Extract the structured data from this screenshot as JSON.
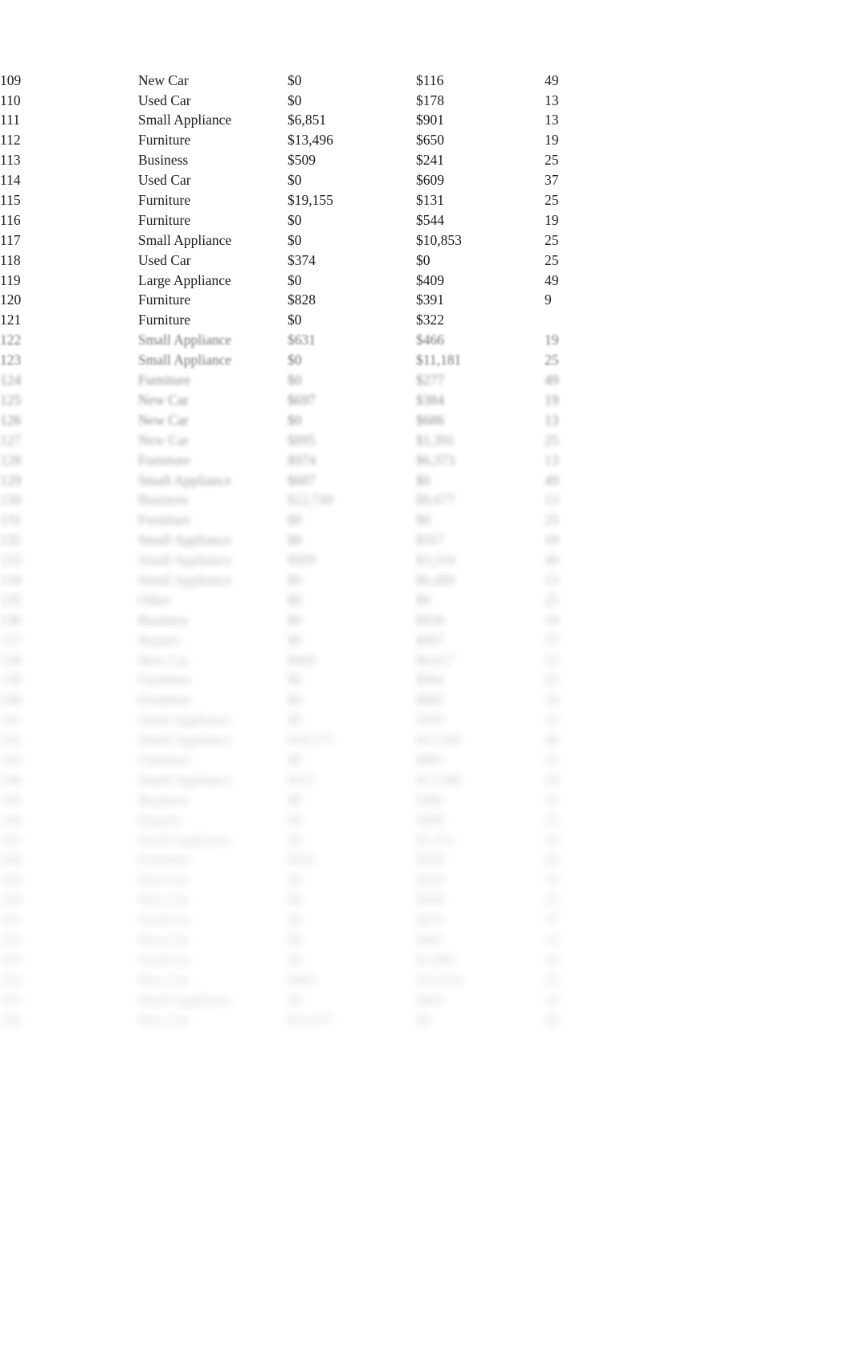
{
  "document": {
    "kind": "spreadsheet-data-table",
    "background_color": "#ffffff",
    "text_color": "#1a1a1a",
    "columns": [
      {
        "key": "index",
        "name": "row-number",
        "align": "right"
      },
      {
        "key": "category",
        "name": "loan-category",
        "align": "right"
      },
      {
        "key": "amount1",
        "name": "amount-column-1",
        "align": "right"
      },
      {
        "key": "amount2",
        "name": "amount-column-2",
        "align": "right"
      },
      {
        "key": "count",
        "name": "count-column",
        "align": "right"
      }
    ],
    "rows": [
      {
        "index": "109",
        "category": "New Car",
        "amount1": "$0",
        "amount2": "$116",
        "count": "49",
        "blur": 0
      },
      {
        "index": "110",
        "category": "Used Car",
        "amount1": "$0",
        "amount2": "$178",
        "count": "13",
        "blur": 0
      },
      {
        "index": "111",
        "category": "Small Appliance",
        "amount1": "$6,851",
        "amount2": "$901",
        "count": "13",
        "blur": 0
      },
      {
        "index": "112",
        "category": "Furniture",
        "amount1": "$13,496",
        "amount2": "$650",
        "count": "19",
        "blur": 0
      },
      {
        "index": "113",
        "category": "Business",
        "amount1": "$509",
        "amount2": "$241",
        "count": "25",
        "blur": 0
      },
      {
        "index": "114",
        "category": "Used Car",
        "amount1": "$0",
        "amount2": "$609",
        "count": "37",
        "blur": 0
      },
      {
        "index": "115",
        "category": "Furniture",
        "amount1": "$19,155",
        "amount2": "$131",
        "count": "25",
        "blur": 0
      },
      {
        "index": "116",
        "category": "Furniture",
        "amount1": "$0",
        "amount2": "$544",
        "count": "19",
        "blur": 0
      },
      {
        "index": "117",
        "category": "Small Appliance",
        "amount1": "$0",
        "amount2": "$10,853",
        "count": "25",
        "blur": 0
      },
      {
        "index": "118",
        "category": "Used Car",
        "amount1": "$374",
        "amount2": "$0",
        "count": "25",
        "blur": 0
      },
      {
        "index": "119",
        "category": "Large Appliance",
        "amount1": "$0",
        "amount2": "$409",
        "count": "49",
        "blur": 0
      },
      {
        "index": "120",
        "category": "Furniture",
        "amount1": "$828",
        "amount2": "$391",
        "count": "9",
        "blur": 0
      },
      {
        "index": "121",
        "category": "Furniture",
        "amount1": "$0",
        "amount2": "$322",
        "count": "",
        "blur": 0
      },
      {
        "index": "122",
        "category": "Small Appliance",
        "amount1": "$631",
        "amount2": "$466",
        "count": "19",
        "blur": 1
      },
      {
        "index": "123",
        "category": "Small Appliance",
        "amount1": "$0",
        "amount2": "$11,181",
        "count": "25",
        "blur": 1
      },
      {
        "index": "124",
        "category": "Furniture",
        "amount1": "$0",
        "amount2": "$277",
        "count": "49",
        "blur": 2
      },
      {
        "index": "125",
        "category": "New Car",
        "amount1": "$697",
        "amount2": "$384",
        "count": "19",
        "blur": 2
      },
      {
        "index": "126",
        "category": "New Car",
        "amount1": "$0",
        "amount2": "$686",
        "count": "13",
        "blur": 2
      },
      {
        "index": "127",
        "category": "New Car",
        "amount1": "$895",
        "amount2": "$1,391",
        "count": "25",
        "blur": 3
      },
      {
        "index": "128",
        "category": "Furniture",
        "amount1": "$974",
        "amount2": "$6,373",
        "count": "13",
        "blur": 3
      },
      {
        "index": "129",
        "category": "Small Appliance",
        "amount1": "$687",
        "amount2": "$0",
        "count": "49",
        "blur": 3
      },
      {
        "index": "130",
        "category": "Business",
        "amount1": "$12,749",
        "amount2": "$8,677",
        "count": "13",
        "blur": 4
      },
      {
        "index": "131",
        "category": "Furniture",
        "amount1": "$0",
        "amount2": "$0",
        "count": "25",
        "blur": 4
      },
      {
        "index": "132",
        "category": "Small Appliance",
        "amount1": "$0",
        "amount2": "$317",
        "count": "19",
        "blur": 4
      },
      {
        "index": "133",
        "category": "Small Appliance",
        "amount1": "$689",
        "amount2": "$3,334",
        "count": "49",
        "blur": 5
      },
      {
        "index": "134",
        "category": "Small Appliance",
        "amount1": "$0",
        "amount2": "$6,489",
        "count": "13",
        "blur": 5
      },
      {
        "index": "135",
        "category": "Other",
        "amount1": "$0",
        "amount2": "$0",
        "count": "25",
        "blur": 5
      },
      {
        "index": "136",
        "category": "Business",
        "amount1": "$0",
        "amount2": "$936",
        "count": "19",
        "blur": 5
      },
      {
        "index": "137",
        "category": "Repairs",
        "amount1": "$0",
        "amount2": "$887",
        "count": "37",
        "blur": 6
      },
      {
        "index": "138",
        "category": "New Car",
        "amount1": "$849",
        "amount2": "$6,617",
        "count": "13",
        "blur": 6
      },
      {
        "index": "139",
        "category": "Furniture",
        "amount1": "$0",
        "amount2": "$964",
        "count": "25",
        "blur": 6
      },
      {
        "index": "140",
        "category": "Furniture",
        "amount1": "$0",
        "amount2": "$802",
        "count": "19",
        "blur": 6
      },
      {
        "index": "141",
        "category": "Small Appliance",
        "amount1": "$0",
        "amount2": "$303",
        "count": "13",
        "blur": 7
      },
      {
        "index": "142",
        "category": "Small Appliance",
        "amount1": "$10,373",
        "amount2": "$11,568",
        "count": "49",
        "blur": 7
      },
      {
        "index": "143",
        "category": "Furniture",
        "amount1": "$0",
        "amount2": "$881",
        "count": "25",
        "blur": 7
      },
      {
        "index": "144",
        "category": "Small Appliance",
        "amount1": "$317",
        "amount2": "$13,506",
        "count": "19",
        "blur": 7
      },
      {
        "index": "145",
        "category": "Business",
        "amount1": "$0",
        "amount2": "$282",
        "count": "13",
        "blur": 7
      },
      {
        "index": "146",
        "category": "Repairs",
        "amount1": "$0",
        "amount2": "$889",
        "count": "25",
        "blur": 8
      },
      {
        "index": "147",
        "category": "Small Appliance",
        "amount1": "$0",
        "amount2": "$1,251",
        "count": "19",
        "blur": 8
      },
      {
        "index": "148",
        "category": "Furniture",
        "amount1": "$935",
        "amount2": "$399",
        "count": "49",
        "blur": 8
      },
      {
        "index": "149",
        "category": "New Car",
        "amount1": "$0",
        "amount2": "$566",
        "count": "13",
        "blur": 8
      },
      {
        "index": "150",
        "category": "New Car",
        "amount1": "$0",
        "amount2": "$690",
        "count": "25",
        "blur": 8
      },
      {
        "index": "151",
        "category": "Used Car",
        "amount1": "$0",
        "amount2": "$473",
        "count": "37",
        "blur": 8
      },
      {
        "index": "152",
        "category": "New Car",
        "amount1": "$0",
        "amount2": "$607",
        "count": "13",
        "blur": 8
      },
      {
        "index": "153",
        "category": "Used Car",
        "amount1": "$0",
        "amount2": "$1,066",
        "count": "19",
        "blur": 8
      },
      {
        "index": "154",
        "category": "New Car",
        "amount1": "$683",
        "amount2": "$12,254",
        "count": "25",
        "blur": 8
      },
      {
        "index": "155",
        "category": "Small Appliance",
        "amount1": "$0",
        "amount2": "$663",
        "count": "13",
        "blur": 8
      },
      {
        "index": "156",
        "category": "New Car",
        "amount1": "$14,277",
        "amount2": "$0",
        "count": "49",
        "blur": 8
      }
    ]
  }
}
